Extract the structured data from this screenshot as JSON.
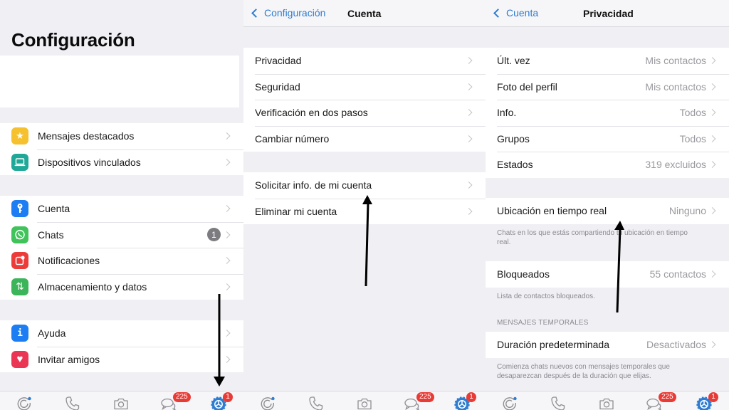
{
  "colors": {
    "background": "#efeff4",
    "link_blue": "#2f7cd0",
    "badge_red": "#e93b35",
    "secondary_text": "#9a9aa0"
  },
  "panel1": {
    "title": "Configuración",
    "groups": [
      [
        {
          "label": "Mensajes destacados",
          "icon": "star-icon",
          "icon_color": "#f5c12f",
          "glyph": "★"
        },
        {
          "label": "Dispositivos vinculados",
          "icon": "laptop-icon",
          "icon_color": "#1fa797",
          "glyph": "💻"
        }
      ],
      [
        {
          "label": "Cuenta",
          "icon": "key-icon",
          "icon_color": "#1c7ef2",
          "glyph": "⚷"
        },
        {
          "label": "Chats",
          "icon": "whatsapp-icon",
          "icon_color": "#3fc35a",
          "glyph": "✆",
          "badge": "1"
        },
        {
          "label": "Notificaciones",
          "icon": "notification-icon",
          "icon_color": "#ec3c3a",
          "glyph": "▢"
        },
        {
          "label": "Almacenamiento y datos",
          "icon": "storage-arrows-icon",
          "icon_color": "#3bb45a",
          "glyph": "⇅"
        }
      ],
      [
        {
          "label": "Ayuda",
          "icon": "info-icon",
          "icon_color": "#1c7ef2",
          "glyph": "i"
        },
        {
          "label": "Invitar amigos",
          "icon": "heart-icon",
          "icon_color": "#ea3654",
          "glyph": "♥"
        }
      ]
    ]
  },
  "panel2": {
    "back_label": "Configuración",
    "title": "Cuenta",
    "groups": [
      [
        "Privacidad",
        "Seguridad",
        "Verificación en dos pasos",
        "Cambiar número"
      ],
      [
        "Solicitar info. de mi cuenta",
        "Eliminar mi cuenta"
      ]
    ]
  },
  "panel3": {
    "back_label": "Cuenta",
    "title": "Privacidad",
    "group1": [
      {
        "label": "Últ. vez",
        "value": "Mis contactos"
      },
      {
        "label": "Foto del perfil",
        "value": "Mis contactos"
      },
      {
        "label": "Info.",
        "value": "Todos"
      },
      {
        "label": "Grupos",
        "value": "Todos"
      },
      {
        "label": "Estados",
        "value": "319 excluidos"
      }
    ],
    "live_location": {
      "label": "Ubicación en tiempo real",
      "value": "Ninguno",
      "footnote": "Chats en los que estás compartiendo tu ubicación en tiempo real."
    },
    "blocked": {
      "label": "Bloqueados",
      "value": "55 contactos",
      "footnote": "Lista de contactos bloqueados."
    },
    "temp_section_header": "MENSAJES TEMPORALES",
    "default_duration": {
      "label": "Duración predeterminada",
      "value": "Desactivados",
      "footnote": "Comienza chats nuevos con mensajes temporales que desaparezcan después de la duración que elijas."
    }
  },
  "tabbar": {
    "tabs": [
      {
        "name": "status",
        "icon": "status-icon"
      },
      {
        "name": "calls",
        "icon": "phone-icon"
      },
      {
        "name": "camera",
        "icon": "camera-icon"
      },
      {
        "name": "chats",
        "icon": "chats-icon",
        "badge": "225"
      },
      {
        "name": "settings",
        "icon": "settings-gear-icon",
        "badge": "1",
        "active": true
      }
    ]
  }
}
